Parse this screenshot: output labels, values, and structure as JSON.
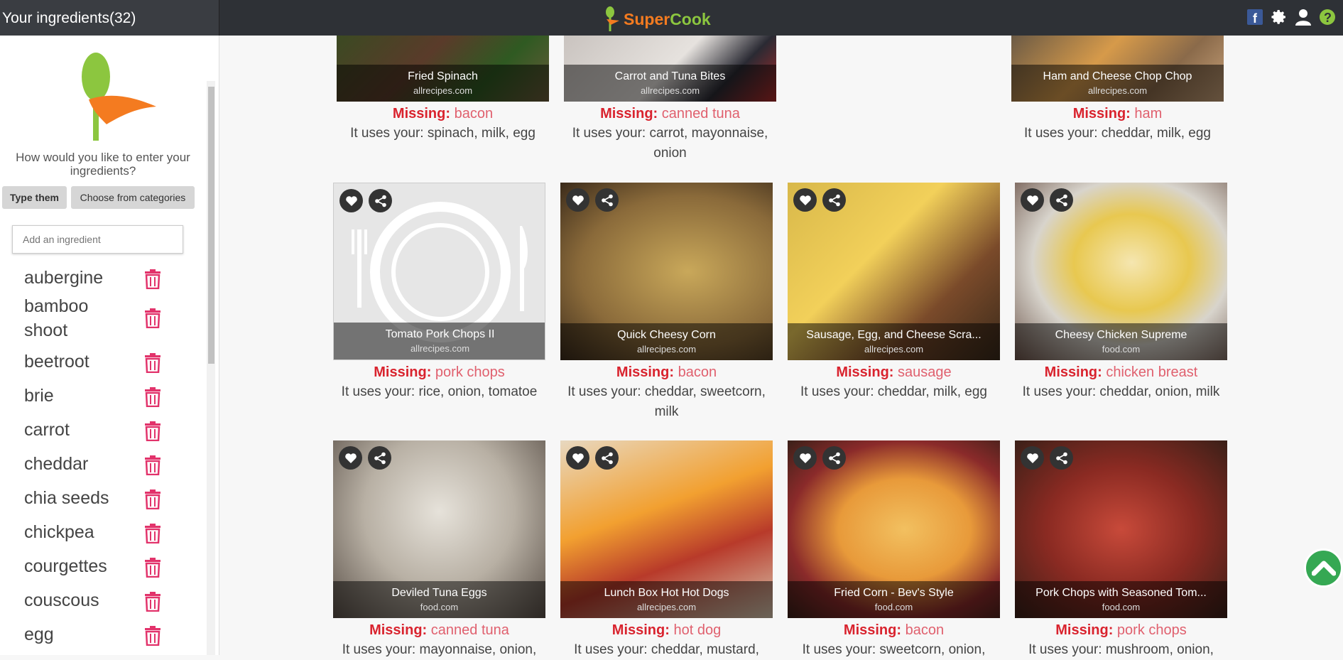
{
  "sidebar": {
    "title": "Your ingredients(32)",
    "question": "How would you like to enter your ingredients?",
    "btn_type": "Type them",
    "btn_categories": "Choose from categories",
    "add_placeholder": "Add an ingredient",
    "ingredients": [
      "aubergine",
      "bamboo shoot",
      "beetroot",
      "brie",
      "carrot",
      "cheddar",
      "chia seeds",
      "chickpea",
      "courgettes",
      "couscous",
      "egg"
    ]
  },
  "header": {
    "brand_a": "Super",
    "brand_b": "Cook"
  },
  "top_icons": [
    "facebook-icon",
    "gear-icon",
    "user-icon",
    "help-icon"
  ],
  "missing_label": "Missing:",
  "recipes": [
    {
      "title": "Fried Spinach",
      "source": "allrecipes.com",
      "missing": "bacon",
      "uses": "It uses your: spinach, milk, egg"
    },
    {
      "title": "Carrot and Tuna Bites",
      "source": "allrecipes.com",
      "missing": "canned tuna",
      "uses": "It uses your: carrot, mayonnaise, onion"
    },
    {
      "title": "Ham and Cheese Chop Chop",
      "source": "allrecipes.com",
      "missing": "ham",
      "uses": "It uses your: cheddar, milk, egg"
    },
    {
      "title": "Tomato Pork Chops II",
      "source": "allrecipes.com",
      "missing": "pork chops",
      "uses": "It uses your: rice, onion, tomatoe"
    },
    {
      "title": "Quick Cheesy Corn",
      "source": "allrecipes.com",
      "missing": "bacon",
      "uses": "It uses your: cheddar, sweetcorn, milk"
    },
    {
      "title": "Sausage, Egg, and Cheese Scra...",
      "source": "allrecipes.com",
      "missing": "sausage",
      "uses": "It uses your: cheddar, milk, egg"
    },
    {
      "title": "Cheesy Chicken Supreme",
      "source": "food.com",
      "missing": "chicken breast",
      "uses": "It uses your: cheddar, onion, milk"
    },
    {
      "title": "Deviled Tuna Eggs",
      "source": "food.com",
      "missing": "canned tuna",
      "uses": "It uses your: mayonnaise, onion,"
    },
    {
      "title": "Lunch Box Hot Hot Dogs",
      "source": "allrecipes.com",
      "missing": "hot dog",
      "uses": "It uses your: cheddar, mustard,"
    },
    {
      "title": "Fried Corn - Bev's Style",
      "source": "food.com",
      "missing": "bacon",
      "uses": "It uses your: sweetcorn, onion,"
    },
    {
      "title": "Pork Chops with Seasoned Tom...",
      "source": "food.com",
      "missing": "pork chops",
      "uses": "It uses your: mushroom, onion,"
    }
  ],
  "colors": {
    "accent_green": "#8cc63f",
    "accent_orange": "#f47b20",
    "missing_red": "#d9232e",
    "trash_pink": "#e2336b"
  }
}
